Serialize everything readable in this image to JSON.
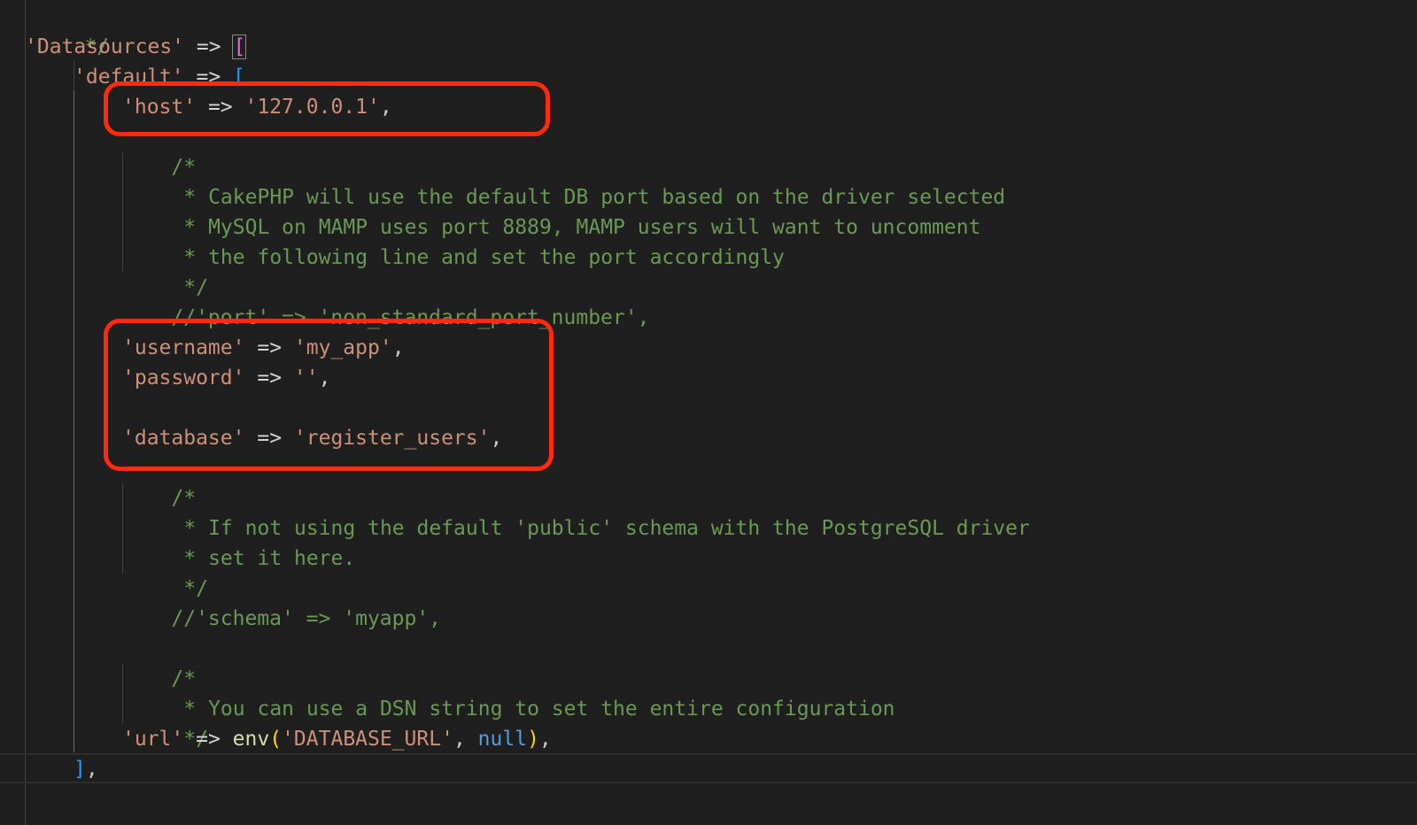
{
  "code": {
    "l1_close": "*/",
    "l2_key": "'Datasources'",
    "arrow": "=>",
    "l2_bracket": "[",
    "l3_key": "'default'",
    "l3_bracket": "[",
    "l4_key": "'host'",
    "l4_val": "'127.0.0.1'",
    "comma": ",",
    "l5_open": "/*",
    "l6": "* CakePHP will use the default DB port based on the driver selected",
    "l7": "* MySQL on MAMP uses port 8889, MAMP users will want to uncomment",
    "l8": "* the following line and set the port accordingly",
    "l9": "*/",
    "l10": "//'port' => 'non_standard_port_number',",
    "l12_key": "'username'",
    "l12_val": "'my_app'",
    "l13_key": "'password'",
    "l13_val": "''",
    "l15_key": "'database'",
    "l15_val": "'register_users'",
    "l16_open": "/*",
    "l17": "* If not using the default 'public' schema with the PostgreSQL driver",
    "l18": "* set it here.",
    "l19": "*/",
    "l20": "//'schema' => 'myapp',",
    "l22_open": "/*",
    "l23": "* You can use a DSN string to set the entire configuration",
    "l24": "*/",
    "l25_key": "'url'",
    "l25_fn": "env",
    "l25_paren_open": "(",
    "l25_arg": "'DATABASE_URL'",
    "l25_null": "null",
    "l25_paren_close": ")",
    "l26_bracket": "]"
  },
  "colors": {
    "background": "#1f1f1f",
    "comment": "#6a9955",
    "string": "#ce9178",
    "highlight_box": "#ff2a10"
  }
}
